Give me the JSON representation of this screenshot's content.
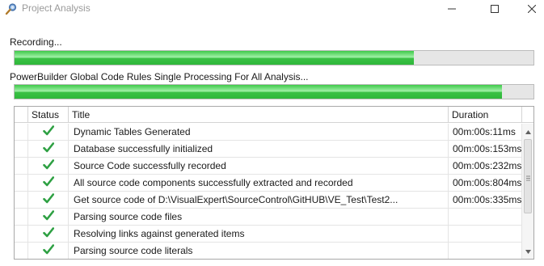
{
  "window": {
    "title": "Project Analysis",
    "icon": "app-magnifier-icon",
    "controls": [
      "minimize-icon",
      "maximize-icon",
      "close-icon"
    ]
  },
  "progress1": {
    "label": "Recording...",
    "fraction": 0.769
  },
  "progress2": {
    "label": "PowerBuilder Global Code Rules Single Processing For All Analysis...",
    "fraction": 0.939
  },
  "table": {
    "columns": [
      "Status",
      "Title",
      "Duration"
    ],
    "rows": [
      {
        "status": "check-icon",
        "title": "Dynamic Tables Generated",
        "duration": "00m:00s:11ms"
      },
      {
        "status": "check-icon",
        "title": "Database successfully initialized",
        "duration": "00m:00s:153ms"
      },
      {
        "status": "check-icon",
        "title": "Source Code successfully recorded",
        "duration": "00m:00s:232ms"
      },
      {
        "status": "check-icon",
        "title": "All source code components successfully extracted and recorded",
        "duration": "00m:00s:804ms"
      },
      {
        "status": "check-icon",
        "title": "Get source code of D:\\VisualExpert\\SourceControl\\GitHUB\\VE_Test\\Test2...",
        "duration": "00m:00s:335ms"
      },
      {
        "status": "check-icon",
        "title": "Parsing source code files",
        "duration": ""
      },
      {
        "status": "check-icon",
        "title": "Resolving links against generated items",
        "duration": ""
      },
      {
        "status": "check-icon",
        "title": "Parsing source code literals",
        "duration": ""
      }
    ]
  },
  "colors": {
    "progress_green": "#3fc94a",
    "check_green": "#2ea043",
    "title_text": "#9a9a9a"
  }
}
